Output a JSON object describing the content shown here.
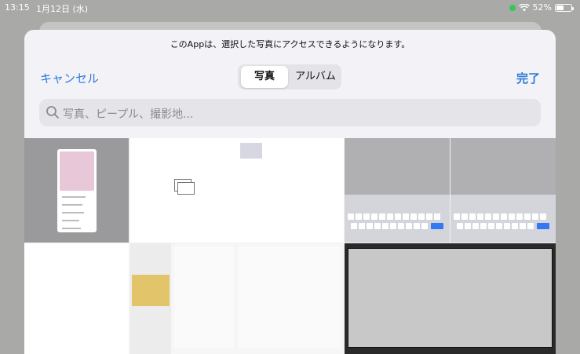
{
  "status": {
    "time": "13:15",
    "date": "1月12日 (水)",
    "battery": "52%",
    "battery_level": 0.52
  },
  "sheet": {
    "note": "このAppは、選択した写真にアクセスできるようになります。",
    "cancel": "キャンセル",
    "done": "完了",
    "segments": {
      "photos": "写真",
      "albums": "アルバム"
    },
    "search_placeholder": "写真、ピープル、撮影地..."
  },
  "colors": {
    "accent": "#2f7bd8",
    "sheet_bg": "#f2f2f7",
    "dimmed_bg": "#a9a9a7"
  }
}
